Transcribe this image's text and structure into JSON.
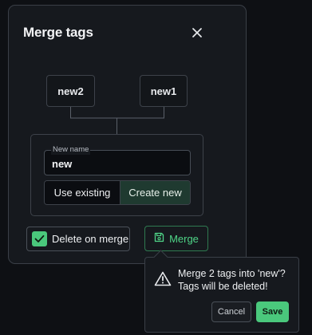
{
  "dialog": {
    "title": "Merge tags",
    "source_tags": [
      "new2",
      "new1"
    ],
    "new_name": {
      "label": "New name",
      "value": "new"
    },
    "mode_options": {
      "use_existing": "Use existing",
      "create_new": "Create new",
      "selected": "create_new"
    },
    "delete_on_merge": {
      "label": "Delete on merge",
      "checked": true
    },
    "merge_button": "Merge"
  },
  "confirm_popover": {
    "message_line1": "Merge 2 tags into 'new'?",
    "message_line2": "Tags will be deleted!",
    "cancel_label": "Cancel",
    "save_label": "Save"
  },
  "icons": {
    "close": "close-icon",
    "checkmark": "checkmark-icon",
    "merge": "floppy-disk-icon",
    "warning": "warning-triangle-icon"
  },
  "colors": {
    "accent": "#4ac87c",
    "selected_segment": "#1f3a30",
    "background": "#0e1014",
    "panel": "#16191e"
  }
}
